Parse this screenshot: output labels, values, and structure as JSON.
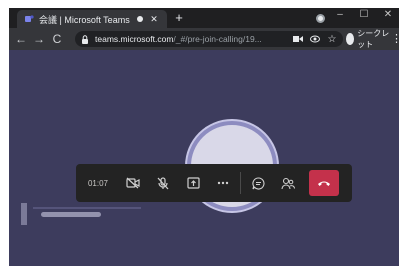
{
  "browser": {
    "tab": {
      "title": "会議 | Microsoft Teams",
      "close_label": "✕",
      "favicon": "teams-icon"
    },
    "new_tab_label": "+",
    "window_controls": [
      "–",
      "☐",
      "✕"
    ],
    "address_bar": {
      "host": "teams.microsoft.com",
      "path": "/_#/pre-join-calling/19..."
    },
    "profile_label": "シークレット"
  },
  "call": {
    "timer": "01:07",
    "controls": [
      "video-off-icon",
      "mic-off-icon",
      "share-screen-icon",
      "more-options-icon",
      "chat-icon",
      "participants-icon",
      "hang-up-icon"
    ],
    "colors": {
      "hangup": "#c4314b",
      "bar": "#232323",
      "stage": "#3d3c5d",
      "avatar_ring": "#8d8cc0"
    }
  }
}
